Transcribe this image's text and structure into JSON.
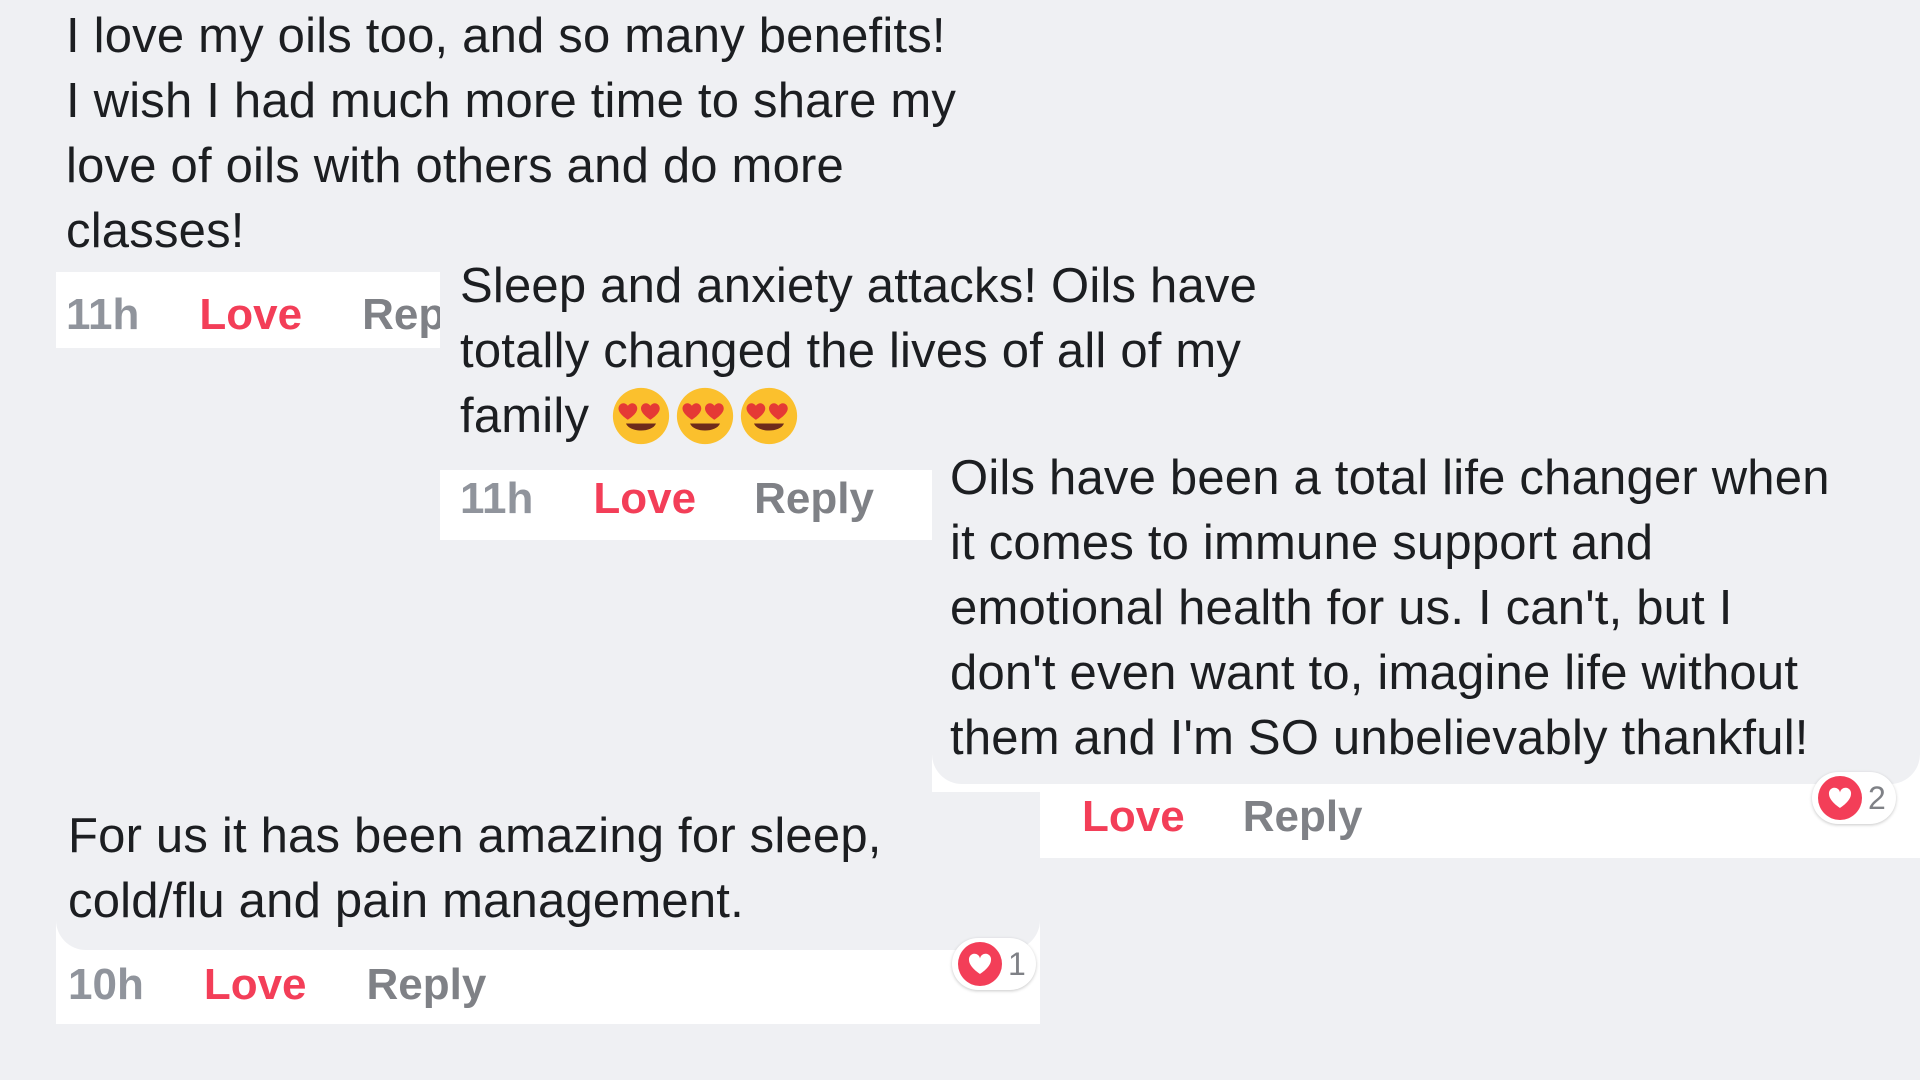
{
  "comments": [
    {
      "lines": [
        "I love my oils too, and so many benefits!",
        "I wish I had much more time to share my",
        "love of oils with others and do more",
        "classes!"
      ],
      "time": "11h",
      "love_label": "Love",
      "reply_label": "Repl"
    },
    {
      "lines": [
        "Sleep and anxiety attacks! Oils have",
        "totally changed the lives of all of my",
        "family"
      ],
      "emoji": [
        "smiling-face-with-heart-eyes-icon",
        "smiling-face-with-heart-eyes-icon",
        "smiling-face-with-heart-eyes-icon"
      ],
      "time": "11h",
      "love_label": "Love",
      "reply_label": "Reply"
    },
    {
      "lines": [
        "Oils have been a total life changer when",
        "it comes to immune support and",
        "emotional health for us. I can't, but I",
        "don't even want to, imagine life without",
        "them and I'm SO unbelievably thankful!"
      ],
      "love_label": "Love",
      "reply_label": "Reply",
      "reaction": {
        "icon": "heart-icon",
        "count": "2"
      }
    },
    {
      "lines": [
        "For us it has been amazing for sleep,",
        "cold/flu and pain management."
      ],
      "time": "10h",
      "love_label": "Love",
      "reply_label": "Reply",
      "reaction": {
        "icon": "heart-icon",
        "count": "1"
      }
    }
  ],
  "colors": {
    "background": "#eff0f3",
    "card": "#ffffff",
    "love": "#f33e58",
    "meta": "#90949c",
    "text": "#1c1e21"
  }
}
